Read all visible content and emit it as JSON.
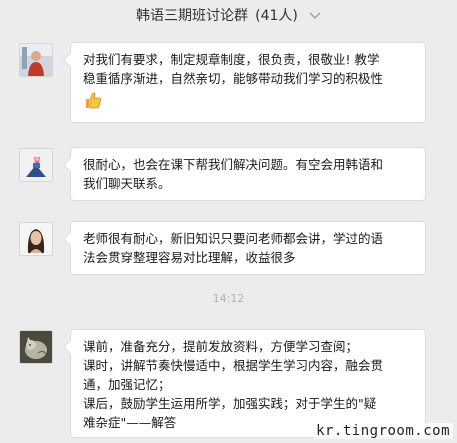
{
  "header": {
    "title": "韩语三期班讨论群",
    "member_count": "(41人)",
    "chevron_icon": "chevron-down-icon"
  },
  "messages": [
    {
      "avatar_icon": "avatar-person",
      "lines": [
        "对我们有要求，制定规章制度，很负责，很敬业! 教学",
        "稳重循序渐进，自然亲切，能够带动我们学习的积极性"
      ],
      "emoji": "thumbs-up-icon"
    },
    {
      "avatar_icon": "avatar-cartoon",
      "lines": [
        "很耐心，也会在课下帮我们解决问题。有空会用韩语和",
        "我们聊天联系。"
      ]
    },
    {
      "avatar_icon": "avatar-woman",
      "lines": [
        "老师很有耐心，新旧知识只要问老师都会讲，学过的语",
        "法会贯穿整理容易对比理解，收益很多"
      ]
    },
    {
      "avatar_icon": "avatar-cat",
      "lines": [
        "课前，准备充分，提前发放资料，方便学习查阅；",
        "课时，讲解节奏快慢适中，根据学生学习内容，融会贯",
        "通，加强记忆；",
        "课后，鼓励学生运用所学，加强实践；对于学生的\"疑",
        "难杂症\"——解答"
      ]
    }
  ],
  "timestamp": "14:12",
  "watermark": "kr.tingroom.com"
}
